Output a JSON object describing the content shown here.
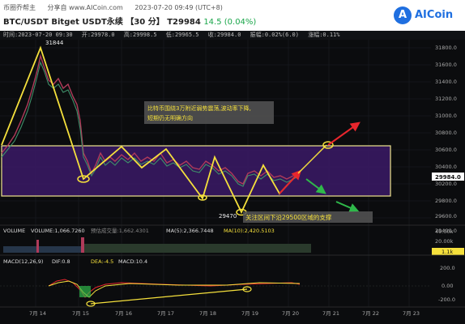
{
  "header": {
    "links": [
      "币圈乔帮主",
      "分享自 www.AICoin.com"
    ],
    "timestamp": "2023-07-20 09:49 (UTC+8)",
    "title": "BTC/USDT Bitget USDT永续 【30 分】",
    "price": "T29984",
    "change": "14.5 (0.04%)",
    "logo_text": "AICoin"
  },
  "infobar": {
    "time": "时间:2023-07-20 09:30",
    "open": "开:29978.0",
    "high": "高:29998.5",
    "low": "低:29965.5",
    "close": "收:29984.0",
    "amplitude": "振幅:0.02%(6.0)",
    "change": "涨幅:0.11%"
  },
  "price_axis": [
    "31800.0",
    "31600.0",
    "31400.0",
    "31200.0",
    "31000.0",
    "30800.0",
    "30600.0",
    "30400.0",
    "30200.0",
    "29800.0",
    "29600.0",
    "29400.0"
  ],
  "current_price": "29984.0",
  "annotations": {
    "peak": "31844",
    "low": "29470",
    "note_top": "比特币围绕3万附近弱势震荡,波动率下降,\n短期仍无明确方向",
    "note_bottom": "关注区间下沿29500区域的支撑"
  },
  "volume": {
    "label": "VOLUME",
    "value": "VOLUME:1,066.7260",
    "forecast": "预估成交量:1,662.4301",
    "ma5": "MA(5):2,366.7448",
    "ma10": "MA(10):2,420.5103",
    "axis": [
      "40.00k",
      "20.00k",
      "1.1k"
    ]
  },
  "macd": {
    "label": "MACD(12,26,9)",
    "dif": "DIF:0.8",
    "dea": "DEA:-4.5",
    "macd": "MACD:10.4",
    "axis": [
      "200.0",
      "0.00",
      "-200.0"
    ]
  },
  "x_axis": [
    "7月 14",
    "7月 15",
    "7月 16",
    "7月 17",
    "7月 18",
    "7月 19",
    "7月 20",
    "7月 21",
    "7月 22",
    "7月 23"
  ],
  "colors": {
    "zone": "#3b1a66",
    "zone_border": "#f0e68c",
    "yellow": "#f5e03c",
    "up_arrow": "#e8262d",
    "down_arrow": "#2fb84a",
    "note_bg": "#555555"
  }
}
